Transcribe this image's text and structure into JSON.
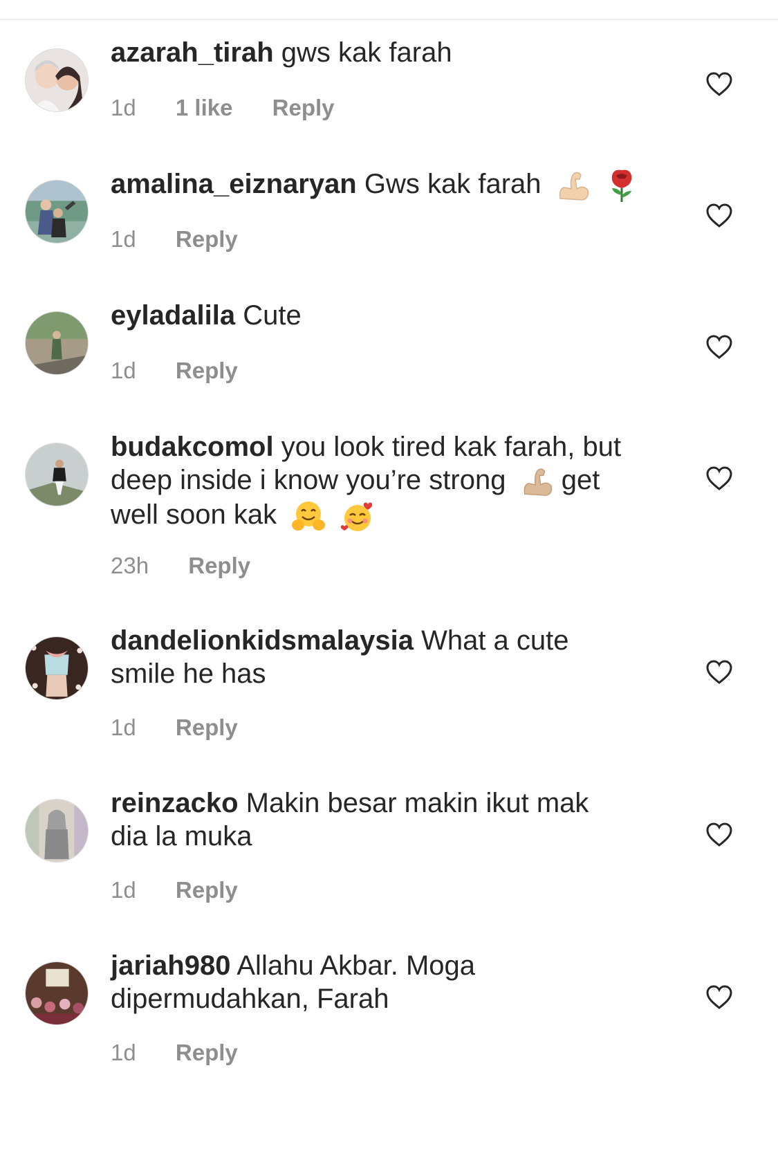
{
  "comments": [
    {
      "username": "azarah_tirah",
      "text": "gws kak farah",
      "time": "1d",
      "likes": "1 like",
      "reply": "Reply"
    },
    {
      "username": "amalina_eiznaryan",
      "text": "Gws kak farah",
      "time": "1d",
      "likes": "",
      "reply": "Reply",
      "emojis": [
        "flexed-biceps-emoji",
        "rose-emoji"
      ]
    },
    {
      "username": "eyladalila",
      "text": "Cute",
      "time": "1d",
      "likes": "",
      "reply": "Reply"
    },
    {
      "username": "budakcomol",
      "text_lines": [
        "you look tired kak farah, but",
        "deep inside i know you’re strong",
        "get",
        "well soon kak"
      ],
      "time": "23h",
      "likes": "",
      "reply": "Reply",
      "emojis": [
        "flexed-biceps-emoji",
        "hugging-face-emoji",
        "smiling-face-with-hearts-emoji"
      ]
    },
    {
      "username": "dandelionkidsmalaysia",
      "text_lines": [
        "What a cute",
        "smile he has"
      ],
      "time": "1d",
      "likes": "",
      "reply": "Reply"
    },
    {
      "username": "reinzacko",
      "text_lines": [
        "Makin besar makin ikut mak",
        "dia la muka"
      ],
      "time": "1d",
      "likes": "",
      "reply": "Reply"
    },
    {
      "username": "jariah980",
      "text_lines": [
        "Allahu Akbar. Moga",
        "dipermudahkan, Farah"
      ],
      "time": "1d",
      "likes": "",
      "reply": "Reply"
    }
  ],
  "colors": {
    "text": "#262626",
    "meta": "#8e8e8e",
    "heart_stroke": "#262626"
  }
}
